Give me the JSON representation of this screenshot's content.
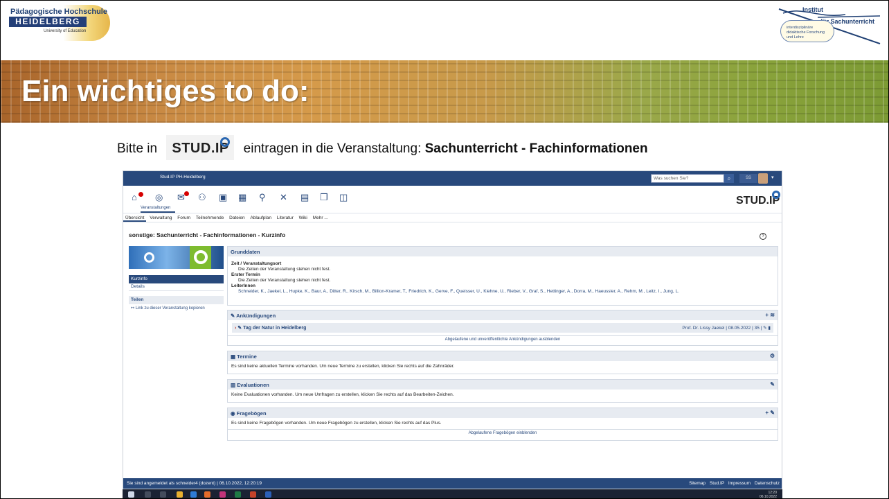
{
  "slide": {
    "ph_logo": {
      "line1": "Pädagogische Hochschule",
      "line2": "HEIDELBERG",
      "line3": "University of Education"
    },
    "inst_logo": {
      "line1": "Institut",
      "line2": "für Sachunterricht",
      "box": "interdisziplinäre didaktische Forschung und Lehre"
    },
    "title": "Ein wichtiges to do:",
    "instruction": {
      "pre": "Bitte in",
      "logo": "STUD.IP",
      "mid": "eintragen in die Veranstaltung:",
      "course": "Sachunterricht - Fachinformationen"
    }
  },
  "studip": {
    "topbar": {
      "site": "Stud.IP PH-Heidelberg",
      "search_placeholder": "Was suchen Sie?",
      "user_initials": "SS"
    },
    "nav_label": "Veranstaltungen",
    "logo": "STUD.IP",
    "tabs": [
      "Übersicht",
      "Verwaltung",
      "Forum",
      "Teilnehmende",
      "Dateien",
      "Ablaufplan",
      "Literatur",
      "Wiki",
      "Mehr ..."
    ],
    "page_title": "sonstige: Sachunterricht - Fachinformationen - Kurzinfo",
    "sidebar": {
      "active": "Kurzinfo",
      "item": "Details",
      "share_header": "Teilen",
      "share_link": "Link zu dieser Veranstaltung kopieren"
    },
    "grunddaten": {
      "header": "Grunddaten",
      "zeit_label": "Zeit / Veranstaltungsort",
      "zeit_text": "Die Zeiten der Veranstaltung stehen nicht fest.",
      "termin_label": "Erster Termin",
      "termin_text": "Die Zeiten der Veranstaltung stehen nicht fest.",
      "leiter_label": "LeiterInnen",
      "leiter_text": "Schneider, K., Jaekel, L., Hupke, K., Baur, A., Ditter, R., Kirsch, M., Billion-Kramer, T., Friedrich, K., Gerve, F., Queisser, U., Kiehne, U., Rieber, V., Graf, S., Hettinger, A., Dorra, M., Haeussler, A., Rehm, M., Leitz, I., Jung, L."
    },
    "ankuendigungen": {
      "header": "Ankündigungen",
      "item_title": "Tag der Natur in Heidelberg",
      "item_author": "Prof. Dr. Lissy Jaekel",
      "item_date": "08.05.2022",
      "item_views": "35",
      "footer_link": "Abgelaufene und unveröffentlichte Ankündigungen ausblenden"
    },
    "termine": {
      "header": "Termine",
      "text": "Es sind keine aktuellen Termine vorhanden. Um neue Termine zu erstellen, klicken Sie rechts auf die Zahnräder."
    },
    "evaluationen": {
      "header": "Evaluationen",
      "text": "Keine Evaluationen vorhanden. Um neue Umfragen zu erstellen, klicken Sie rechts auf das Bearbeiten-Zeichen."
    },
    "frageboegen": {
      "header": "Fragebögen",
      "text": "Es sind keine Fragebögen vorhanden. Um neue Fragebögen zu erstellen, klicken Sie rechts auf das Plus.",
      "footer_link": "Abgelaufene Fragebögen einblenden"
    },
    "footer": {
      "left": "Sie sind angemeldet als schneider4 (dozent) | 06.10.2022, 12:20:19",
      "links": [
        "Sitemap",
        "Stud.IP",
        "Impressum",
        "Datenschutz"
      ]
    }
  },
  "taskbar": {
    "time": "12:20",
    "date": "06.10.2022"
  },
  "colors": {
    "studip_blue": "#28497c",
    "panel_header": "#e7ebf1",
    "badge_red": "#d60000"
  }
}
